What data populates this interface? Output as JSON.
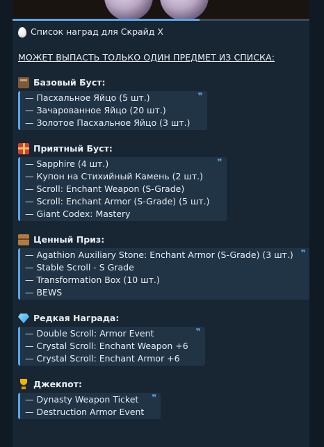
{
  "message": {
    "title": "Список наград для Скрайд Х",
    "notice": "МОЖЕТ ВЫПАСТЬ ТОЛЬКО ОДИН ПРЕДМЕТ ИЗ СПИСКА:",
    "media_progress": 0.63
  },
  "sections": [
    {
      "icon": "box-icon",
      "title": "Базовый Буст:",
      "items": [
        "— Пасхальное Яйцо (5 шт.)",
        "— Зачарованное Яйцо (20 шт.)",
        "— Золотое Пасхальное Яйцо (3 шт.)"
      ]
    },
    {
      "icon": "gift-icon",
      "title": "Приятный Буст:",
      "items": [
        "— Sapphire (4 шт.)",
        "— Купон на Стихийный Камень (2 шт.)",
        "— Scroll: Enchant Weapon (S-Grade)",
        "— Scroll: Enchant Armor (S-Grade) (5 шт.)",
        "— Giant Codex: Mastery"
      ]
    },
    {
      "icon": "package-icon",
      "title": "Ценный Приз:",
      "items": [
        "— Agathion Auxiliary Stone: Enchant Armor (S-Grade) (3 шт.)",
        "— Stable Scroll - S Grade",
        "— Transformation Box (10 шт.)",
        "— BEWS"
      ]
    },
    {
      "icon": "gem-icon",
      "title": "Редкая Награда:",
      "items": [
        "— Double Scroll: Armor Event",
        "— Crystal Scroll: Enchant Weapon +6",
        "— Crystal Scroll: Enchant Armor +6"
      ]
    },
    {
      "icon": "trophy-icon",
      "title": "Джекпот:",
      "items": [
        "— Dynasty Weapon Ticket",
        "— Destruction Armor Event"
      ]
    }
  ]
}
